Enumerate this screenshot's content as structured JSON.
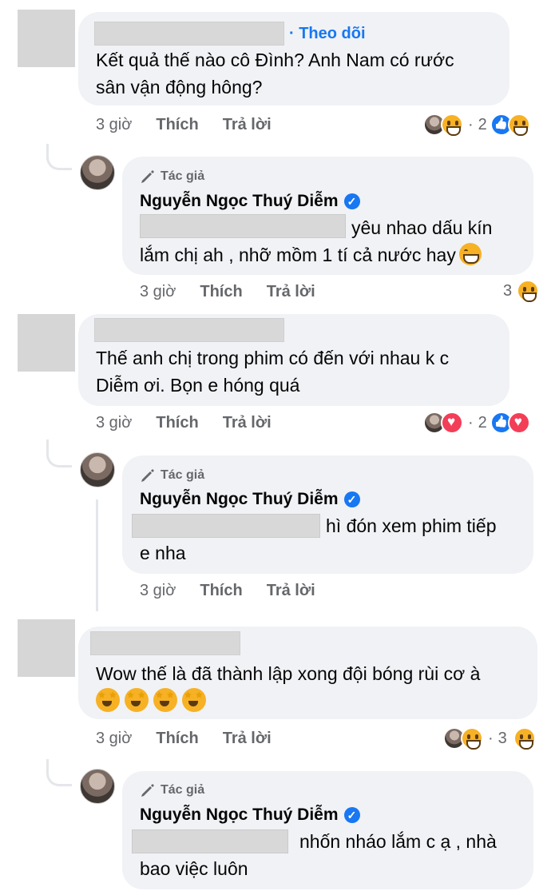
{
  "comments": [
    {
      "text": [
        "Kết quả thế nào cô Đình? Anh Nam có rước",
        "sân vận động hông?"
      ],
      "follow_label": "· Theo dõi",
      "time": "3 giờ",
      "like_label": "Thích",
      "reply_label": "Trả lời",
      "reaction_count": "2",
      "reply": {
        "author_badge": "Tác giả",
        "author": "Nguyễn Ngọc Thuý Diễm",
        "text": [
          "yêu nhao dấu kín",
          "lắm chị ah , nhỡ mồm 1 tí cả nước hay"
        ],
        "time": "3 giờ",
        "like_label": "Thích",
        "reply_label": "Trả lời",
        "reaction_count": "3"
      }
    },
    {
      "text": [
        "Thế anh chị trong phim có đến với nhau k c",
        "Diễm ơi. Bọn e hóng quá"
      ],
      "time": "3 giờ",
      "like_label": "Thích",
      "reply_label": "Trả lời",
      "reaction_count": "2",
      "reply": {
        "author_badge": "Tác giả",
        "author": "Nguyễn Ngọc Thuý Diễm",
        "text": [
          "hì đón xem phim tiếp",
          "e nha"
        ],
        "time": "3 giờ",
        "like_label": "Thích",
        "reply_label": "Trả lời"
      }
    },
    {
      "text": [
        "Wow thế là đã thành lập xong đội bóng rùi cơ à"
      ],
      "time": "3 giờ",
      "like_label": "Thích",
      "reply_label": "Trả lời",
      "reaction_count": "3",
      "reply": {
        "author_badge": "Tác giả",
        "author": "Nguyễn Ngọc Thuý Diễm",
        "text": [
          "nhốn nháo lắm c ạ , nhà",
          "bao việc luôn"
        ]
      }
    }
  ],
  "colors": {
    "accent": "#1877f2",
    "bubble": "#f0f2f5",
    "meta": "#65676b",
    "heart": "#f33e58",
    "haha": "#f7b125"
  }
}
